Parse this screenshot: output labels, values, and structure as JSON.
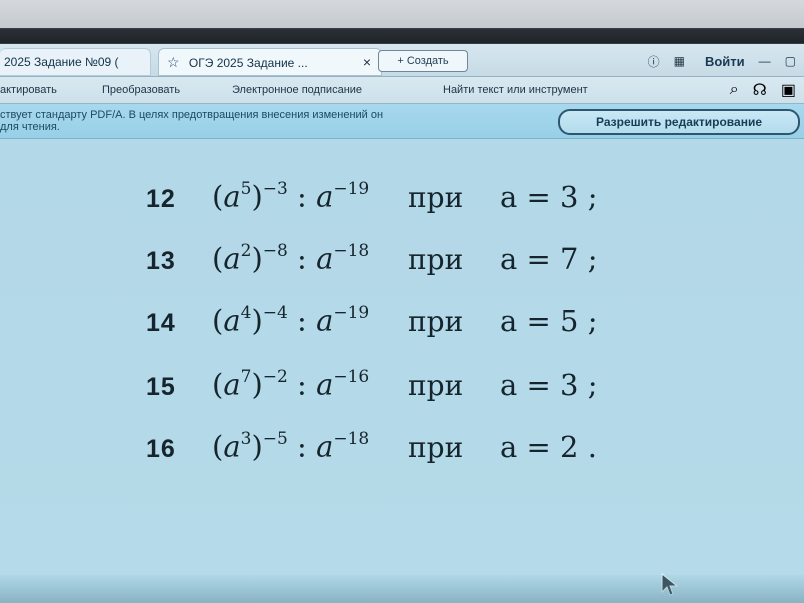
{
  "tabs": {
    "left_tab": "2025 Задание №09 (",
    "active_tab": "ОГЭ 2025 Задание ..."
  },
  "header": {
    "new_tab_label": "Создать",
    "login_label": "Войти"
  },
  "toolbar": {
    "edit_label": "актировать",
    "convert_label": "Преобразовать",
    "sign_label": "Электронное подписание",
    "search_label": "Найти текст или инструмент"
  },
  "notice": {
    "line1": "ствует стандарту PDF/A. В целях предотвращения внесения изменений он",
    "line2": "для чтения.",
    "action": "Разрешить редактирование"
  },
  "problems": [
    {
      "number": "12",
      "base": "a",
      "power": "5",
      "outer_power": "−3",
      "divisor_power": "−19",
      "word": "при",
      "value": "a = 3 ;"
    },
    {
      "number": "13",
      "base": "a",
      "power": "2",
      "outer_power": "−8",
      "divisor_power": "−18",
      "word": "при",
      "value": "a = 7 ;"
    },
    {
      "number": "14",
      "base": "a",
      "power": "4",
      "outer_power": "−4",
      "divisor_power": "−19",
      "word": "при",
      "value": "a = 5 ;"
    },
    {
      "number": "15",
      "base": "a",
      "power": "7",
      "outer_power": "−2",
      "divisor_power": "−16",
      "word": "при",
      "value": "a = 3 ;"
    },
    {
      "number": "16",
      "base": "a",
      "power": "3",
      "outer_power": "−5",
      "divisor_power": "−18",
      "word": "при",
      "value": "a = 2 ."
    }
  ]
}
